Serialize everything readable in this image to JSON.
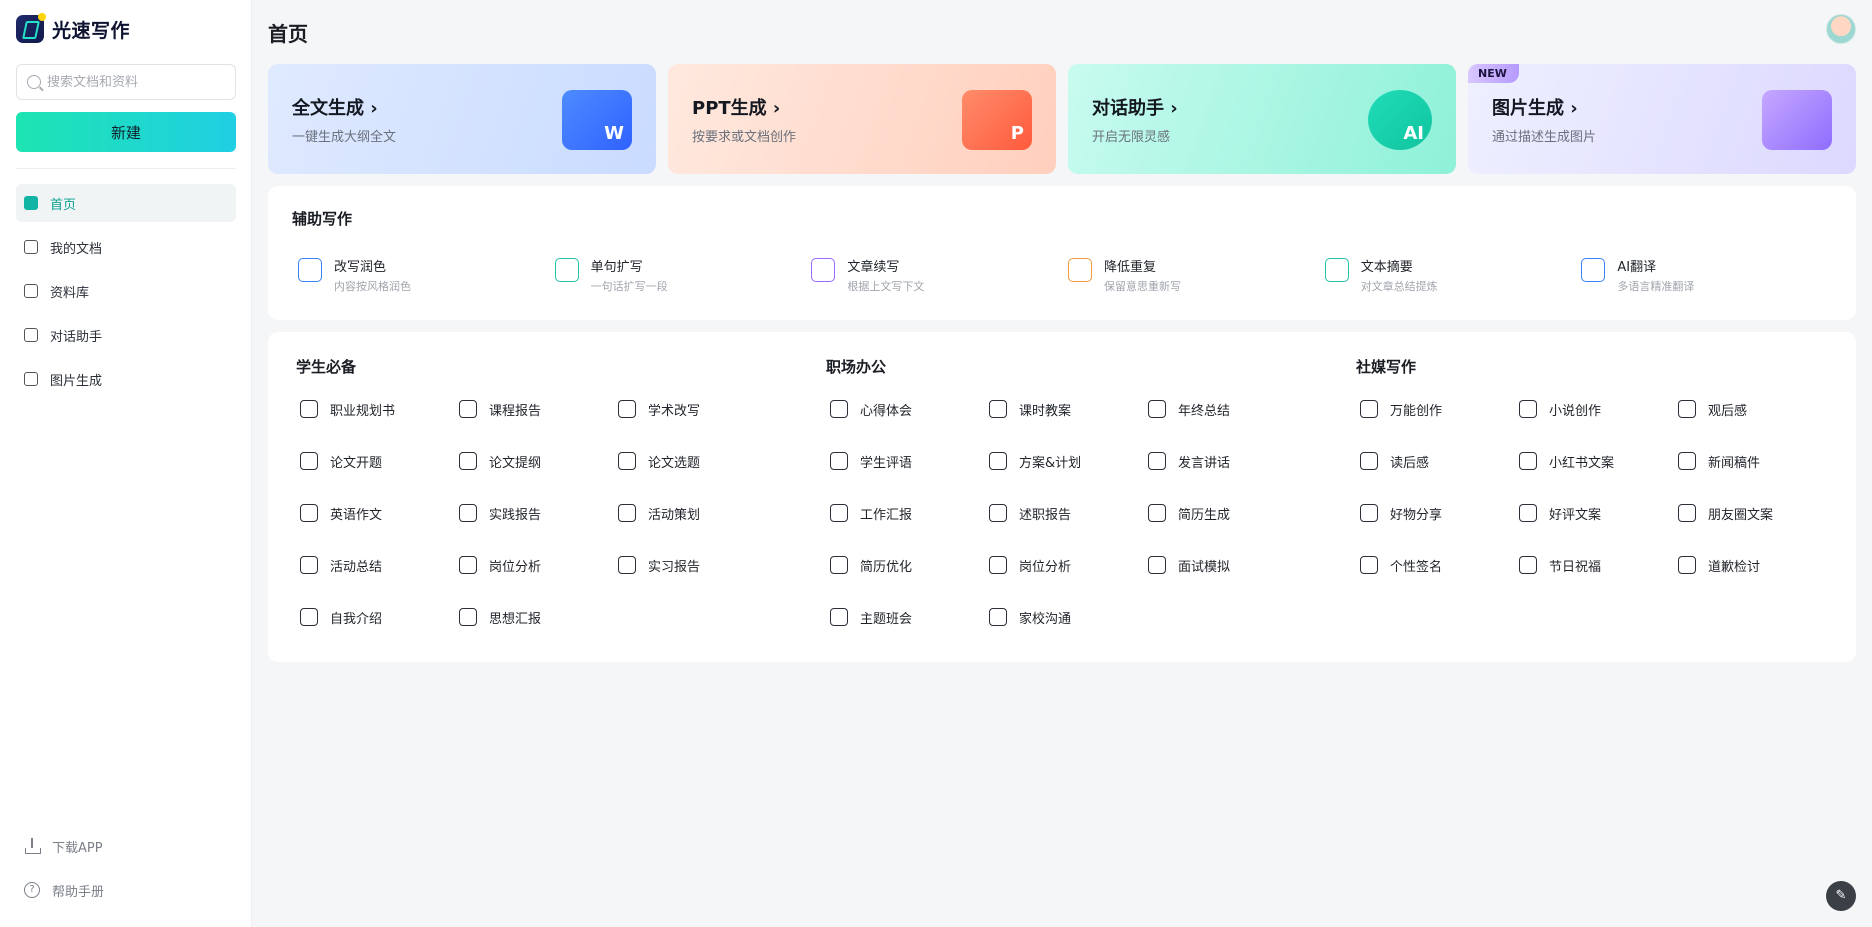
{
  "app": {
    "name": "光速写作"
  },
  "sidebar": {
    "search_placeholder": "搜索文档和资料",
    "new_button": "新建",
    "items": [
      {
        "label": "首页",
        "icon": "home-icon",
        "active": true
      },
      {
        "label": "我的文档",
        "icon": "document-icon",
        "active": false
      },
      {
        "label": "资料库",
        "icon": "library-icon",
        "active": false
      },
      {
        "label": "对话助手",
        "icon": "chat-icon",
        "active": false
      },
      {
        "label": "图片生成",
        "icon": "image-icon",
        "active": false
      }
    ],
    "download_label": "下载APP",
    "help_label": "帮助手册"
  },
  "header": {
    "title": "首页"
  },
  "cards": [
    {
      "title": "全文生成 ›",
      "subtitle": "一键生成大纲全文",
      "icon": "word-doc-icon",
      "badge": ""
    },
    {
      "title": "PPT生成 ›",
      "subtitle": "按要求或文档创作",
      "icon": "presentation-icon",
      "badge": ""
    },
    {
      "title": "对话助手 ›",
      "subtitle": "开启无限灵感",
      "icon": "ai-chat-icon",
      "badge": ""
    },
    {
      "title": "图片生成 ›",
      "subtitle": "通过描述生成图片",
      "icon": "image-gen-icon",
      "badge": "NEW"
    }
  ],
  "assist": {
    "title": "辅助写作",
    "items": [
      {
        "title": "改写润色",
        "subtitle": "内容按风格润色",
        "icon": "polish-icon",
        "color": "#3a83f7"
      },
      {
        "title": "单句扩写",
        "subtitle": "一句话扩写一段",
        "icon": "expand-icon",
        "color": "#1fc3a6"
      },
      {
        "title": "文章续写",
        "subtitle": "根据上文写下文",
        "icon": "continue-icon",
        "color": "#9a6bff"
      },
      {
        "title": "降低重复",
        "subtitle": "保留意思重新写",
        "icon": "dedupe-icon",
        "color": "#f59a3b"
      },
      {
        "title": "文本摘要",
        "subtitle": "对文章总结提炼",
        "icon": "summary-icon",
        "color": "#1fc3a6"
      },
      {
        "title": "AI翻译",
        "subtitle": "多语言精准翻译",
        "icon": "translate-icon",
        "color": "#3a83f7"
      }
    ]
  },
  "tool_sections": [
    {
      "title": "学生必备",
      "items": [
        {
          "label": "职业规划书",
          "icon": "career-plan-icon"
        },
        {
          "label": "课程报告",
          "icon": "course-report-icon"
        },
        {
          "label": "学术改写",
          "icon": "academic-rewrite-icon"
        },
        {
          "label": "论文开题",
          "icon": "thesis-proposal-icon"
        },
        {
          "label": "论文提纲",
          "icon": "thesis-outline-icon"
        },
        {
          "label": "论文选题",
          "icon": "thesis-topic-icon"
        },
        {
          "label": "英语作文",
          "icon": "english-essay-icon"
        },
        {
          "label": "实践报告",
          "icon": "practice-report-icon"
        },
        {
          "label": "活动策划",
          "icon": "event-plan-icon"
        },
        {
          "label": "活动总结",
          "icon": "event-summary-icon"
        },
        {
          "label": "岗位分析",
          "icon": "job-analysis-icon"
        },
        {
          "label": "实习报告",
          "icon": "internship-report-icon"
        },
        {
          "label": "自我介绍",
          "icon": "self-intro-icon"
        },
        {
          "label": "思想汇报",
          "icon": "thought-report-icon"
        }
      ]
    },
    {
      "title": "职场办公",
      "items": [
        {
          "label": "心得体会",
          "icon": "reflection-icon"
        },
        {
          "label": "课时教案",
          "icon": "lesson-plan-icon"
        },
        {
          "label": "年终总结",
          "icon": "year-end-icon"
        },
        {
          "label": "学生评语",
          "icon": "student-comment-icon"
        },
        {
          "label": "方案&计划",
          "icon": "plan-icon"
        },
        {
          "label": "发言讲话",
          "icon": "speech-icon"
        },
        {
          "label": "工作汇报",
          "icon": "work-report-icon"
        },
        {
          "label": "述职报告",
          "icon": "duty-report-icon"
        },
        {
          "label": "简历生成",
          "icon": "resume-icon"
        },
        {
          "label": "简历优化",
          "icon": "resume-optimize-icon"
        },
        {
          "label": "岗位分析",
          "icon": "job-analysis-icon"
        },
        {
          "label": "面试模拟",
          "icon": "interview-icon"
        },
        {
          "label": "主题班会",
          "icon": "class-meeting-icon"
        },
        {
          "label": "家校沟通",
          "icon": "home-school-icon"
        }
      ]
    },
    {
      "title": "社媒写作",
      "items": [
        {
          "label": "万能创作",
          "icon": "universal-create-icon"
        },
        {
          "label": "小说创作",
          "icon": "novel-icon"
        },
        {
          "label": "观后感",
          "icon": "review-icon"
        },
        {
          "label": "读后感",
          "icon": "book-review-icon"
        },
        {
          "label": "小红书文案",
          "icon": "xiaohongshu-icon"
        },
        {
          "label": "新闻稿件",
          "icon": "news-icon"
        },
        {
          "label": "好物分享",
          "icon": "share-icon"
        },
        {
          "label": "好评文案",
          "icon": "thumbs-up-icon"
        },
        {
          "label": "朋友圈文案",
          "icon": "moments-icon"
        },
        {
          "label": "个性签名",
          "icon": "signature-icon"
        },
        {
          "label": "节日祝福",
          "icon": "holiday-icon"
        },
        {
          "label": "道歉检讨",
          "icon": "apology-icon"
        }
      ]
    }
  ]
}
